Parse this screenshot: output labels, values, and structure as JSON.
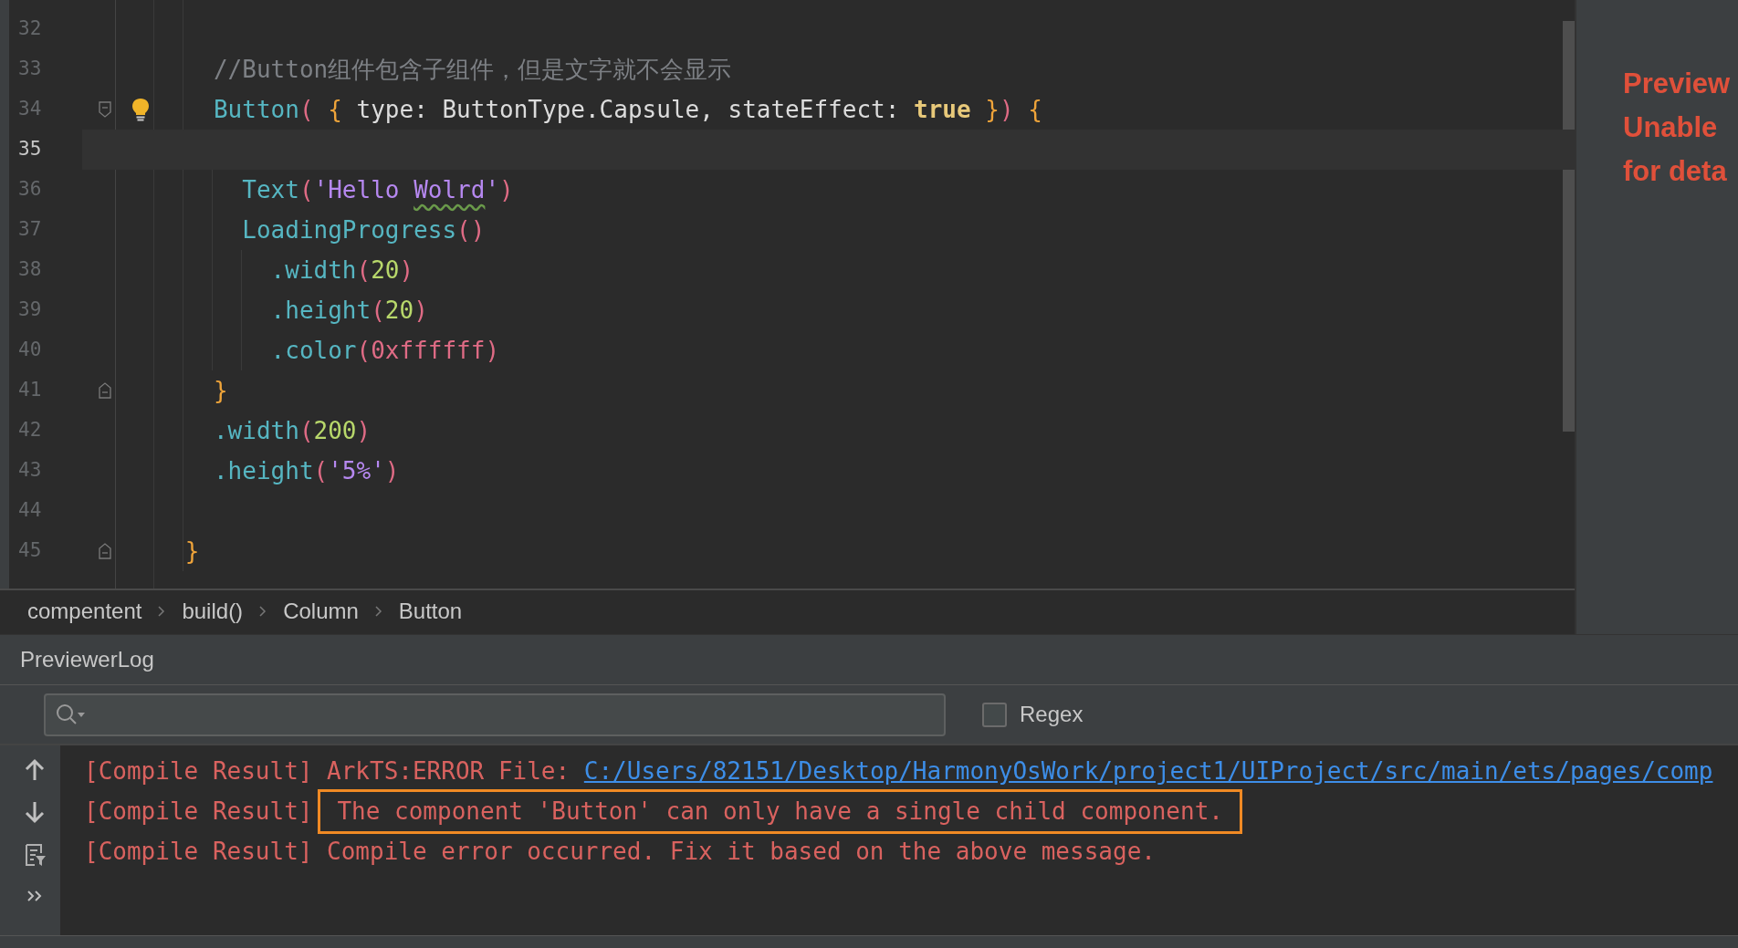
{
  "editor": {
    "lines": [
      {
        "number": "32",
        "current": false,
        "kind": "plain",
        "bulb": false
      },
      {
        "number": "33",
        "current": false,
        "kind": "plain",
        "bulb": false,
        "tokens": [
          {
            "text": "   //Button组件包含子组件，但是文字就不会显示",
            "kind": "comment"
          }
        ]
      },
      {
        "number": "34",
        "current": false,
        "kind": "fold_start",
        "bulb": true,
        "tokens": [
          {
            "text": "   Button",
            "kind": "component"
          },
          {
            "text": "( ",
            "kind": "paren"
          },
          {
            "text": "{",
            "kind": "brace"
          },
          {
            "text": " type: ButtonType.Capsule, stateEffect: ",
            "kind": "plain"
          },
          {
            "text": "true ",
            "kind": "keyword"
          },
          {
            "text": "}",
            "kind": "brace"
          },
          {
            "text": ") ",
            "kind": "paren"
          },
          {
            "text": "{",
            "kind": "brace"
          }
        ]
      },
      {
        "number": "35",
        "current": true,
        "kind": "plain",
        "bulb": false
      },
      {
        "number": "36",
        "current": false,
        "kind": "plain",
        "bulb": false,
        "tokens": [
          {
            "text": "     Text",
            "kind": "component"
          },
          {
            "text": "(",
            "kind": "paren"
          },
          {
            "text": "'Hello ",
            "kind": "string"
          },
          {
            "text": "Wolrd",
            "kind": "string",
            "typo": true
          },
          {
            "text": "'",
            "kind": "string"
          },
          {
            "text": ")",
            "kind": "paren"
          }
        ]
      },
      {
        "number": "37",
        "current": false,
        "kind": "plain",
        "bulb": false,
        "tokens": [
          {
            "text": "     LoadingProgress",
            "kind": "component"
          },
          {
            "text": "()",
            "kind": "paren"
          }
        ]
      },
      {
        "number": "38",
        "current": false,
        "kind": "plain",
        "bulb": false,
        "tokens": [
          {
            "text": "       .width",
            "kind": "method"
          },
          {
            "text": "(",
            "kind": "paren"
          },
          {
            "text": "20",
            "kind": "number"
          },
          {
            "text": ")",
            "kind": "paren"
          }
        ]
      },
      {
        "number": "39",
        "current": false,
        "kind": "plain",
        "bulb": false,
        "tokens": [
          {
            "text": "       .height",
            "kind": "method"
          },
          {
            "text": "(",
            "kind": "paren"
          },
          {
            "text": "20",
            "kind": "number"
          },
          {
            "text": ")",
            "kind": "paren"
          }
        ]
      },
      {
        "number": "40",
        "current": false,
        "kind": "plain",
        "bulb": false,
        "tokens": [
          {
            "text": "       .color",
            "kind": "method"
          },
          {
            "text": "(",
            "kind": "paren"
          },
          {
            "text": "0xffffff",
            "kind": "hex"
          },
          {
            "text": ")",
            "kind": "paren"
          }
        ]
      },
      {
        "number": "41",
        "current": false,
        "kind": "fold_end",
        "bulb": false,
        "tokens": [
          {
            "text": "   }",
            "kind": "brace"
          }
        ]
      },
      {
        "number": "42",
        "current": false,
        "kind": "plain",
        "bulb": false,
        "tokens": [
          {
            "text": "   .width",
            "kind": "method"
          },
          {
            "text": "(",
            "kind": "paren"
          },
          {
            "text": "200",
            "kind": "number"
          },
          {
            "text": ")",
            "kind": "paren"
          }
        ]
      },
      {
        "number": "43",
        "current": false,
        "kind": "plain",
        "bulb": false,
        "tokens": [
          {
            "text": "   .height",
            "kind": "method"
          },
          {
            "text": "(",
            "kind": "paren"
          },
          {
            "text": "'5%'",
            "kind": "string"
          },
          {
            "text": ")",
            "kind": "paren"
          }
        ]
      },
      {
        "number": "44",
        "current": false,
        "kind": "plain",
        "bulb": false
      },
      {
        "number": "45",
        "current": false,
        "kind": "fold_end",
        "bulb": false,
        "tokens": [
          {
            "text": " }",
            "kind": "brace"
          }
        ]
      }
    ]
  },
  "breadcrumbs": [
    "compentent",
    "build()",
    "Column",
    "Button"
  ],
  "preview_panel": {
    "message_lines": [
      "Preview",
      "Unable",
      "for deta"
    ]
  },
  "log_panel": {
    "title": "PreviewerLog",
    "regex": {
      "label": "Regex",
      "checked": false
    },
    "entries": [
      {
        "prefix": "[Compile Result]",
        "message": "ArkTS:ERROR File:",
        "link": "C:/Users/82151/Desktop/HarmonyOsWork/project1/UIProject/src/main/ets/pages/comp",
        "highlighted": false
      },
      {
        "prefix": "[Compile Result]",
        "message": "The component 'Button' can only have a single child component.",
        "highlighted": true
      },
      {
        "prefix": "[Compile Result]",
        "message": "Compile error occurred. Fix it based on the above message.",
        "highlighted": false
      }
    ]
  }
}
